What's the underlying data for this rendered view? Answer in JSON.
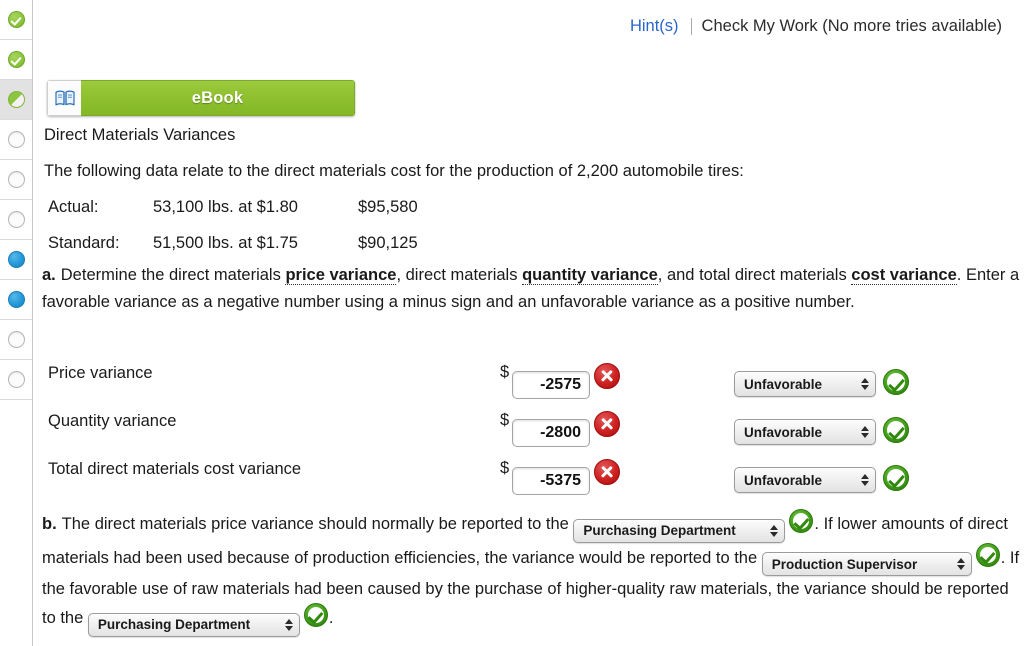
{
  "rail": {
    "items": [
      {
        "name": "item-1",
        "state": "green-check"
      },
      {
        "name": "item-2",
        "state": "green-check"
      },
      {
        "name": "item-3",
        "state": "green-half",
        "current": true
      },
      {
        "name": "item-4",
        "state": "empty"
      },
      {
        "name": "item-5",
        "state": "empty"
      },
      {
        "name": "item-6",
        "state": "empty"
      },
      {
        "name": "item-7",
        "state": "blue"
      },
      {
        "name": "item-8",
        "state": "blue"
      },
      {
        "name": "item-9",
        "state": "empty"
      },
      {
        "name": "item-10",
        "state": "empty"
      }
    ]
  },
  "topbar": {
    "hints_label": "Hint(s)",
    "check_my_work": "Check My Work (No more tries available)",
    "hint_link_color": "#2a66c8"
  },
  "ebook": {
    "label": "eBook",
    "icon": "book-icon",
    "bar_color": "#8dbf2e"
  },
  "content": {
    "heading": "Direct Materials Variances",
    "intro": "The following data relate to the direct materials cost for the production of 2,200 automobile tires:",
    "data_rows": [
      {
        "label": "Actual:",
        "quantity": "53,100 lbs. at $1.80",
        "amount": "$95,580"
      },
      {
        "label": "Standard:",
        "quantity": "51,500 lbs. at $1.75",
        "amount": "$90,125"
      }
    ]
  },
  "question_a": {
    "letter": "a.",
    "text_1": "Determine the direct materials ",
    "term_1": "price variance",
    "text_2": ", direct materials ",
    "term_2": "quantity variance",
    "text_3": ", and total direct materials ",
    "term_3": "cost variance",
    "text_4": ". Enter a favorable variance as a negative number using a minus sign and an unfavorable variance as a positive number.",
    "rows": [
      {
        "label": "Price variance",
        "currency": "$",
        "value": "-2575",
        "value_status": "incorrect",
        "select_value": "Unfavorable",
        "select_status": "correct"
      },
      {
        "label": "Quantity variance",
        "currency": "$",
        "value": "-2800",
        "value_status": "incorrect",
        "select_value": "Unfavorable",
        "select_status": "correct"
      },
      {
        "label": "Total direct materials cost variance",
        "currency": "$",
        "value": "-5375",
        "value_status": "incorrect",
        "select_value": "Unfavorable",
        "select_status": "correct"
      }
    ]
  },
  "question_b": {
    "letter": "b.",
    "text_1": "The direct materials price variance should normally be reported to the ",
    "select_1": "Purchasing Department",
    "select_1_status": "correct",
    "text_2": ". If lower amounts of direct materials had been used because of production efficiencies, the variance would be reported to the ",
    "select_2": "Production Supervisor",
    "select_2_status": "correct",
    "text_3": ". If the favorable use of raw materials had been caused by the purchase of higher-quality raw materials, the variance should be reported to the ",
    "select_3": "Purchasing Department",
    "select_3_status": "correct",
    "text_4": "."
  }
}
